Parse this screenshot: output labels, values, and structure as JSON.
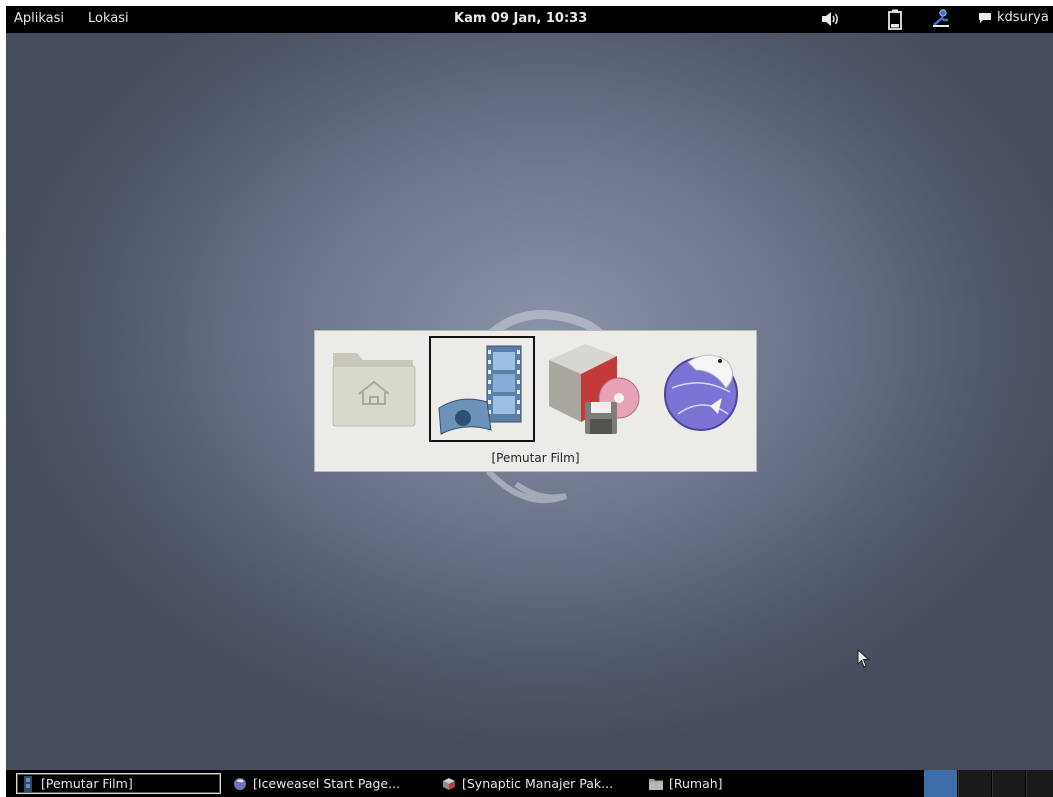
{
  "top_panel": {
    "menu_applications": "Aplikasi",
    "menu_places": "Lokasi",
    "clock": "Kam 09 Jan, 10:33",
    "user_name": "kdsurya"
  },
  "switcher": {
    "items": [
      {
        "icon": "home-folder-icon",
        "name": "Rumah"
      },
      {
        "icon": "video-player-icon",
        "name": "Pemutar Film"
      },
      {
        "icon": "package-manager-icon",
        "name": "Synaptic Manajer Paket"
      },
      {
        "icon": "iceweasel-icon",
        "name": "Iceweasel Start Page"
      }
    ],
    "selected_label": "[Pemutar Film]"
  },
  "taskbar": {
    "tasks": [
      {
        "label": "[Pemutar Film]",
        "icon": "video-player-icon"
      },
      {
        "label": "[Iceweasel Start Page...",
        "icon": "iceweasel-icon"
      },
      {
        "label": "[Synaptic Manajer Pak...",
        "icon": "package-manager-icon"
      },
      {
        "label": "[Rumah]",
        "icon": "folder-icon"
      }
    ],
    "workspaces": 4,
    "active_workspace": 1
  },
  "colors": {
    "panel": "#000000",
    "desktop": "#6d768b",
    "active_workspace": "#3d6ea8"
  }
}
